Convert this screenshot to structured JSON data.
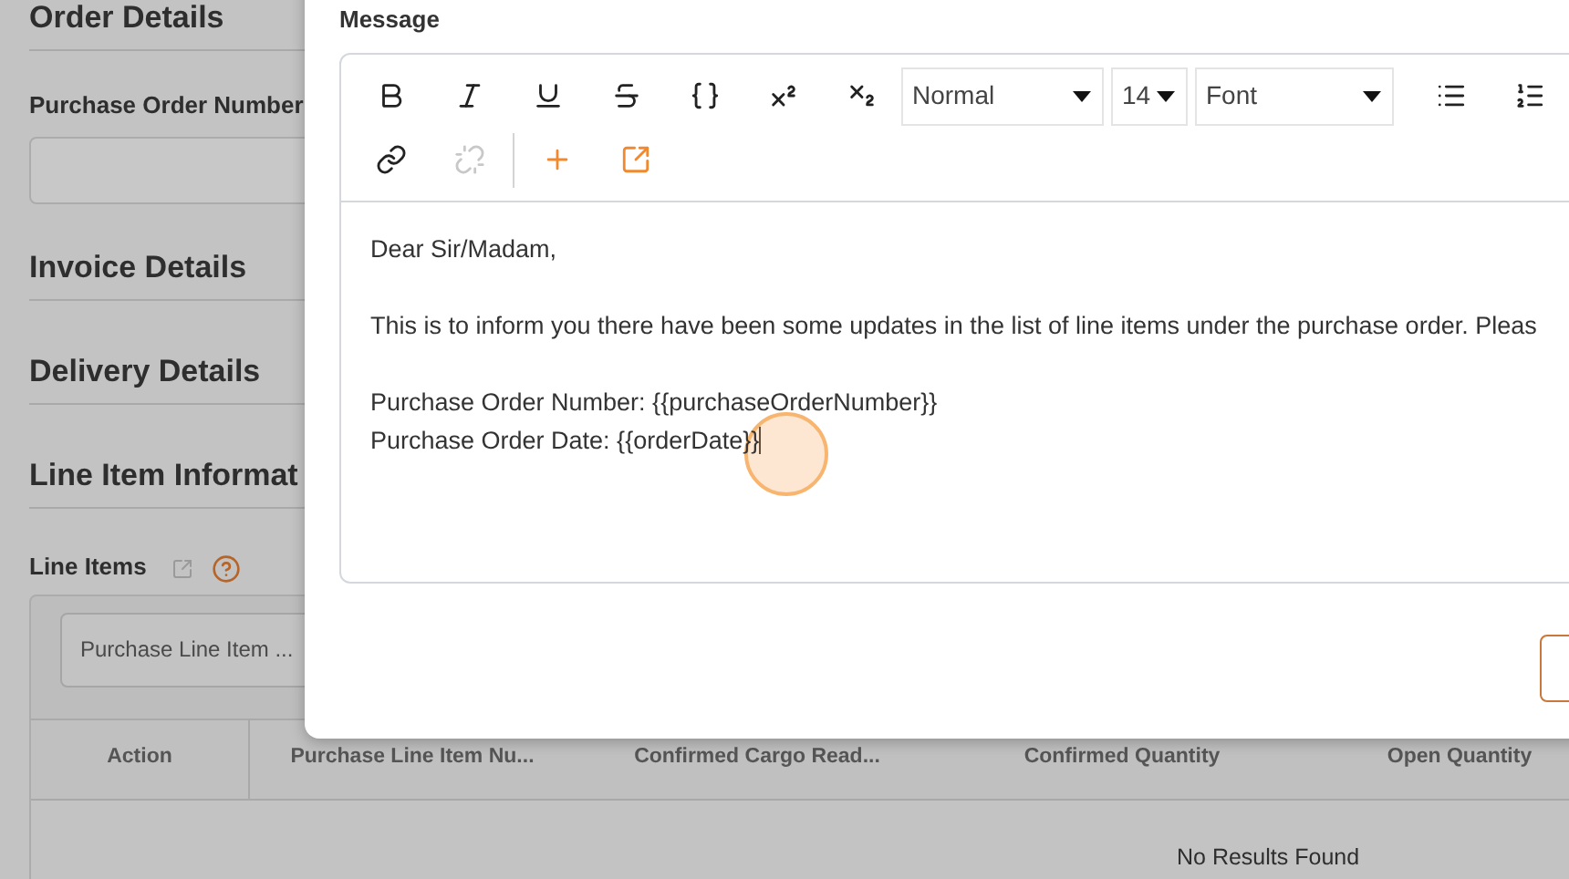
{
  "page": {
    "sections": [
      {
        "title": "Order Details",
        "field_label": "Purchase Order Number"
      },
      {
        "title": "Invoice Details"
      },
      {
        "title": "Delivery Details"
      },
      {
        "title": "Line Item Informat"
      }
    ],
    "line_items": {
      "label": "Line Items",
      "filter_placeholder": "Purchase Line Item ...",
      "columns": [
        "Action",
        "Purchase Line Item Nu...",
        "Confirmed Cargo Read...",
        "Confirmed Quantity",
        "Open Quantity"
      ],
      "empty_text": "No Results Found"
    }
  },
  "modal": {
    "label": "Message",
    "toolbar": {
      "buttons": [
        {
          "disabled": false
        },
        {
          "disabled": false
        },
        {
          "disabled": false
        },
        {
          "disabled": false
        },
        {
          "disabled": false
        },
        {
          "disabled": false
        },
        {
          "disabled": false
        }
      ],
      "selects": [
        {
          "value": "Normal"
        },
        {
          "value": "14"
        },
        {
          "value": "Font"
        }
      ],
      "buttons_after": [
        {
          "disabled": false
        },
        {
          "disabled": false
        }
      ],
      "row2": [
        {
          "disabled": false
        },
        {
          "disabled": true
        },
        {
          "disabled": false
        },
        {
          "disabled": false
        }
      ]
    },
    "paragraphs": [
      [
        "Dear Sir/Madam,"
      ],
      [
        "This is to inform you there have been some updates in the list of line items under the purchase order. Pleas"
      ],
      [
        "Purchase Order Number: {{purchaseOrderNumber}}",
        "Purchase Order Date: {{orderDate}}"
      ]
    ]
  }
}
